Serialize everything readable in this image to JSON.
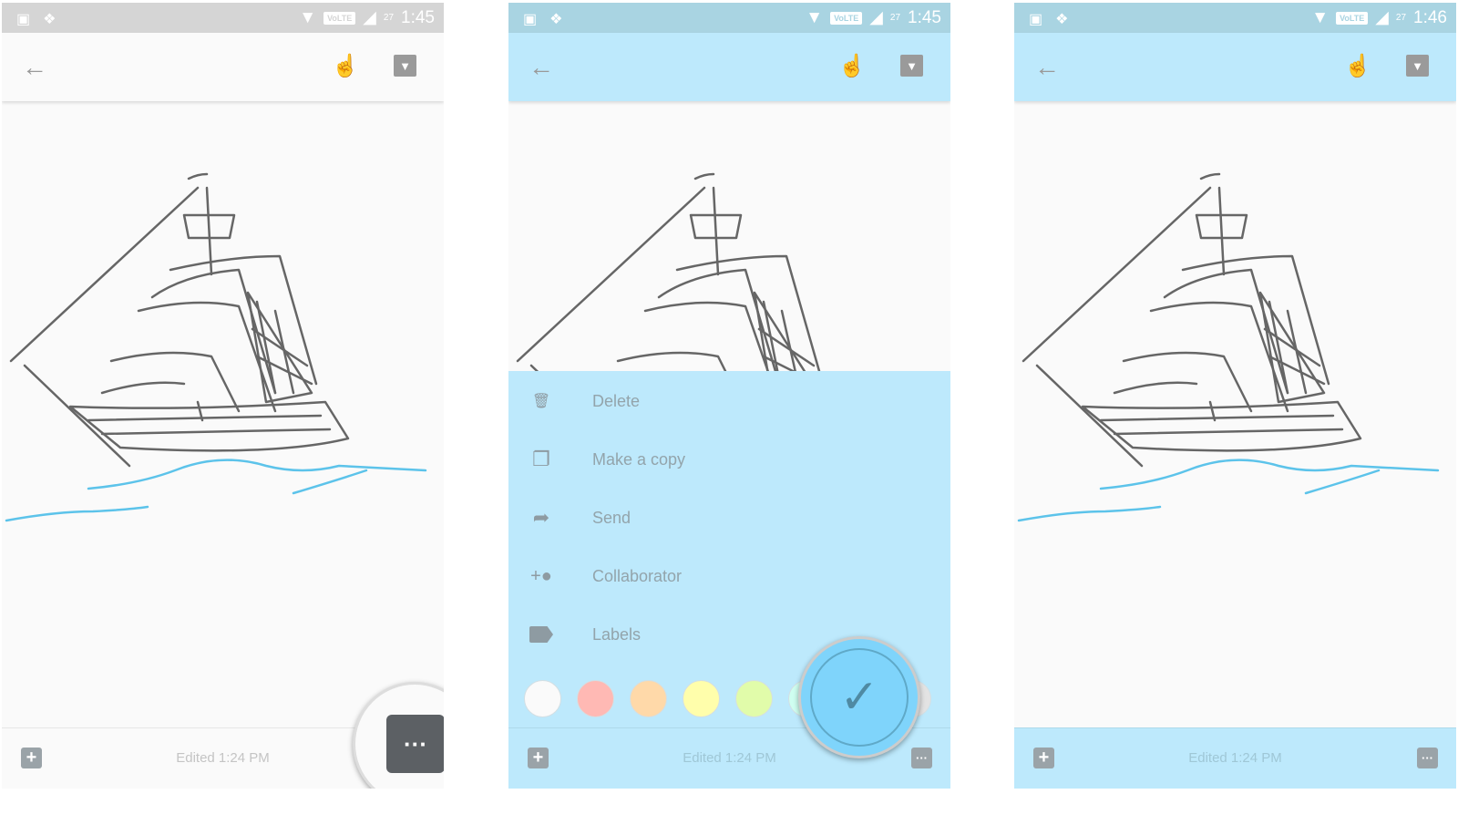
{
  "status_bar": {
    "screens": [
      {
        "time": "1:45"
      },
      {
        "time": "1:45"
      },
      {
        "time": "1:46"
      }
    ],
    "network": "VoLTE",
    "battery": "27"
  },
  "toolbar": {
    "back_icon": "arrow-left-icon",
    "touch_icon": "touch-icon",
    "archive_icon": "archive-icon"
  },
  "bottom_bar": {
    "edited": "Edited 1:24 PM",
    "add_icon": "plus-box-icon",
    "more_icon": "more-dots-icon"
  },
  "menu": {
    "items": [
      {
        "label": "Delete",
        "icon": "trash-icon"
      },
      {
        "label": "Make a copy",
        "icon": "copy-icon"
      },
      {
        "label": "Send",
        "icon": "share-icon"
      },
      {
        "label": "Collaborator",
        "icon": "person-add-icon"
      },
      {
        "label": "Labels",
        "icon": "label-icon"
      }
    ]
  },
  "colors": {
    "selected_note": "#bde9fc",
    "swatches": [
      "#fafafa",
      "#ffb9b4",
      "#ffd9a9",
      "#fffeab",
      "#e1fcaa",
      "#cffef0",
      "#e3e3e3"
    ],
    "ink": "#606060",
    "water": "#5cc3ea"
  }
}
